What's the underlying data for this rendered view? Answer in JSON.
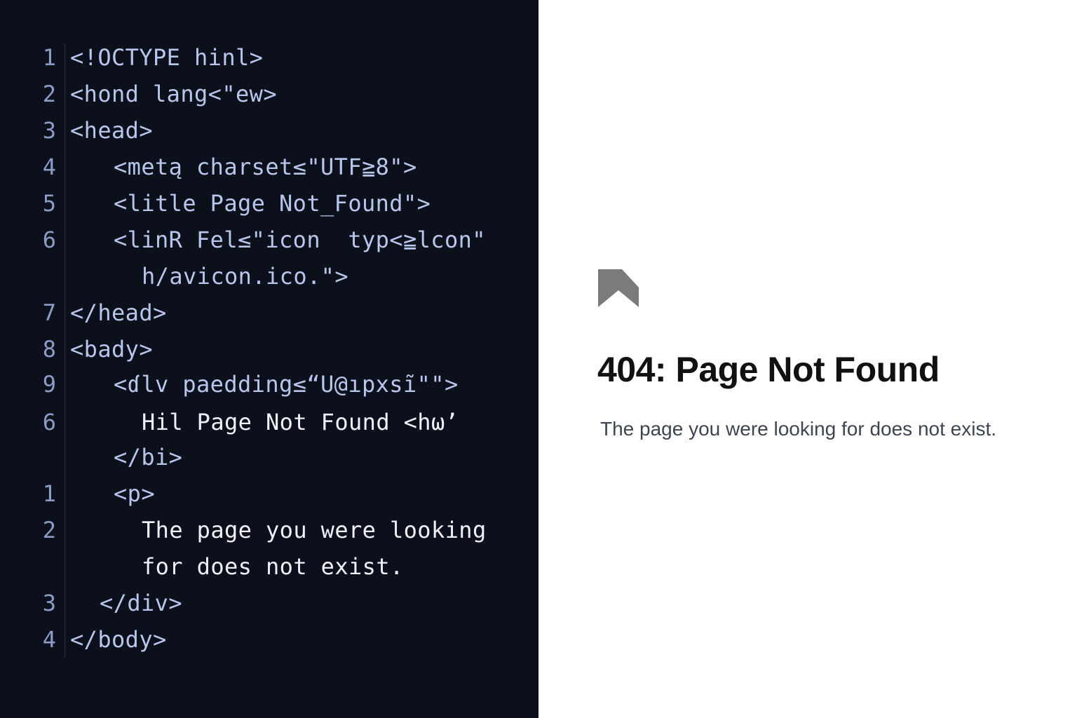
{
  "editor": {
    "lines": [
      {
        "num": "1",
        "text": "<!OCTYPE hinl>"
      },
      {
        "num": "2",
        "text": "<hond lang<\"ew>"
      },
      {
        "num": "3",
        "text": "<head>"
      },
      {
        "num": "4",
        "text": "<metą charset≤\"UTF≧8\">"
      },
      {
        "num": "5",
        "text": "<litle Page Not_Found\">"
      },
      {
        "num": "6",
        "text": "<linR Fel≤\"icon  typ<≧lcon\""
      },
      {
        "num": "",
        "text": "h/avicon.ico.\">"
      },
      {
        "num": "7",
        "text": "</head>"
      },
      {
        "num": "8",
        "text": "<bady>"
      },
      {
        "num": "9",
        "text": "<ɗlv paedding≤“U@ıpxsĩ\"\">"
      },
      {
        "num": "6",
        "text": "Hil Page Not Found <hω’"
      },
      {
        "num": "",
        "text": "</bi>"
      },
      {
        "num": "1",
        "text": "<p>"
      },
      {
        "num": "2",
        "text": "The page you were looking"
      },
      {
        "num": "",
        "text": "for does not exist."
      },
      {
        "num": "3",
        "text": "</div>"
      },
      {
        "num": "4",
        "text": "</body>"
      }
    ]
  },
  "preview": {
    "icon": "bookmark-icon",
    "title": "404: Page Not Found",
    "message": "The page you were looking for does not exist."
  }
}
